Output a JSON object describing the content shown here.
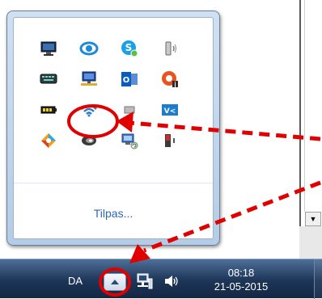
{
  "notification_area": {
    "icons": [
      {
        "name": "display-icon"
      },
      {
        "name": "browser-e-icon"
      },
      {
        "name": "skype-icon"
      },
      {
        "name": "volume-device-icon"
      },
      {
        "name": "keyboard-device-icon"
      },
      {
        "name": "network-computer-icon"
      },
      {
        "name": "outlook-icon"
      },
      {
        "name": "update-app-icon"
      },
      {
        "name": "battery-icon"
      },
      {
        "name": "wireless-network-icon"
      },
      {
        "name": "hidden-icon"
      },
      {
        "name": "vmware-icon"
      },
      {
        "name": "color-app-icon"
      },
      {
        "name": "swirl-app-icon"
      },
      {
        "name": "computer-sync-icon"
      },
      {
        "name": "speaker-device-icon"
      }
    ],
    "customize_link": "Tilpas..."
  },
  "taskbar": {
    "language": "DA",
    "clock": {
      "time": "08:18",
      "date": "21-05-2015"
    }
  },
  "annotations": {
    "color": "#e00000"
  }
}
